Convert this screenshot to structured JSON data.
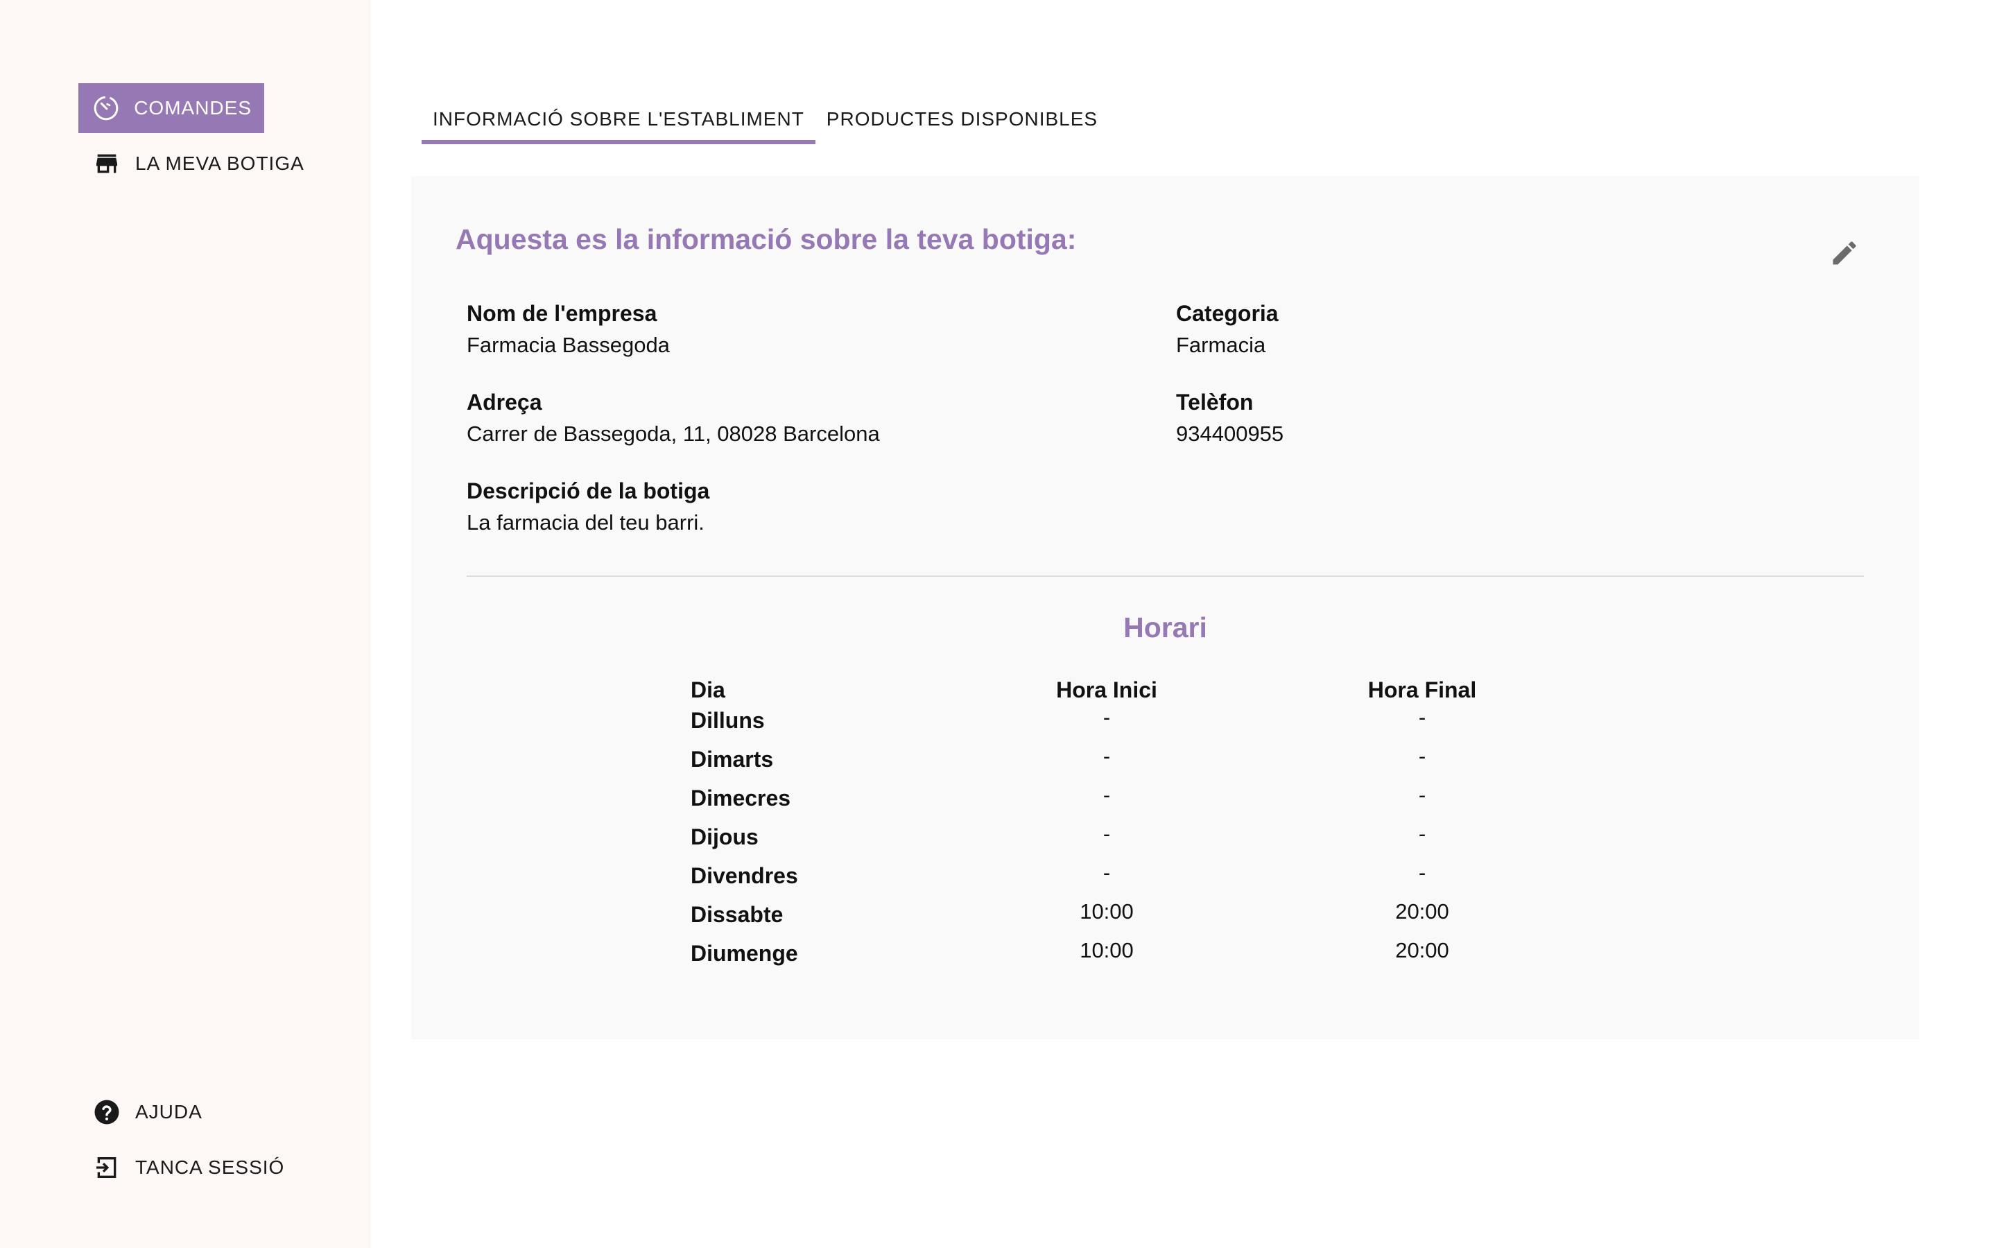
{
  "sidebar": {
    "items": [
      {
        "label": "COMANDES",
        "icon": "orders-timer-icon",
        "active": true
      },
      {
        "label": "LA MEVA BOTIGA",
        "icon": "store-icon",
        "active": false
      }
    ],
    "bottom_items": [
      {
        "label": "AJUDA",
        "icon": "help-icon"
      },
      {
        "label": "TANCA SESSIÓ",
        "icon": "logout-icon"
      }
    ]
  },
  "tabs": [
    {
      "label": "INFORMACIÓ SOBRE L'ESTABLIMENT",
      "active": true
    },
    {
      "label": "PRODUCTES DISPONIBLES",
      "active": false
    }
  ],
  "card": {
    "title": "Aquesta es la informació sobre la teva botiga:",
    "edit_icon": "edit-pencil-icon",
    "fields": {
      "nom": {
        "label": "Nom de l'empresa",
        "value": "Farmacia Bassegoda"
      },
      "categoria": {
        "label": "Categoria",
        "value": "Farmacia"
      },
      "adreca": {
        "label": "Adreça",
        "value": "Carrer de Bassegoda, 11, 08028 Barcelona"
      },
      "telefon": {
        "label": "Telèfon",
        "value": "934400955"
      },
      "descripcio": {
        "label": "Descripció de la botiga",
        "value": "La farmacia del teu barri."
      }
    },
    "horari": {
      "title": "Horari",
      "columns": {
        "dia": "Dia",
        "inici": "Hora Inici",
        "final": "Hora Final"
      },
      "rows": [
        {
          "dia": "Dilluns",
          "inici": "-",
          "final": "-"
        },
        {
          "dia": "Dimarts",
          "inici": "-",
          "final": "-"
        },
        {
          "dia": "Dimecres",
          "inici": "-",
          "final": "-"
        },
        {
          "dia": "Dijous",
          "inici": "-",
          "final": "-"
        },
        {
          "dia": "Divendres",
          "inici": "-",
          "final": "-"
        },
        {
          "dia": "Dissabte",
          "inici": "10:00",
          "final": "20:00"
        },
        {
          "dia": "Diumenge",
          "inici": "10:00",
          "final": "20:00"
        }
      ]
    }
  },
  "colors": {
    "accent": "#9679b4",
    "sidebar_bg": "#fdf8f5",
    "card_bg": "#f9f9f9"
  }
}
